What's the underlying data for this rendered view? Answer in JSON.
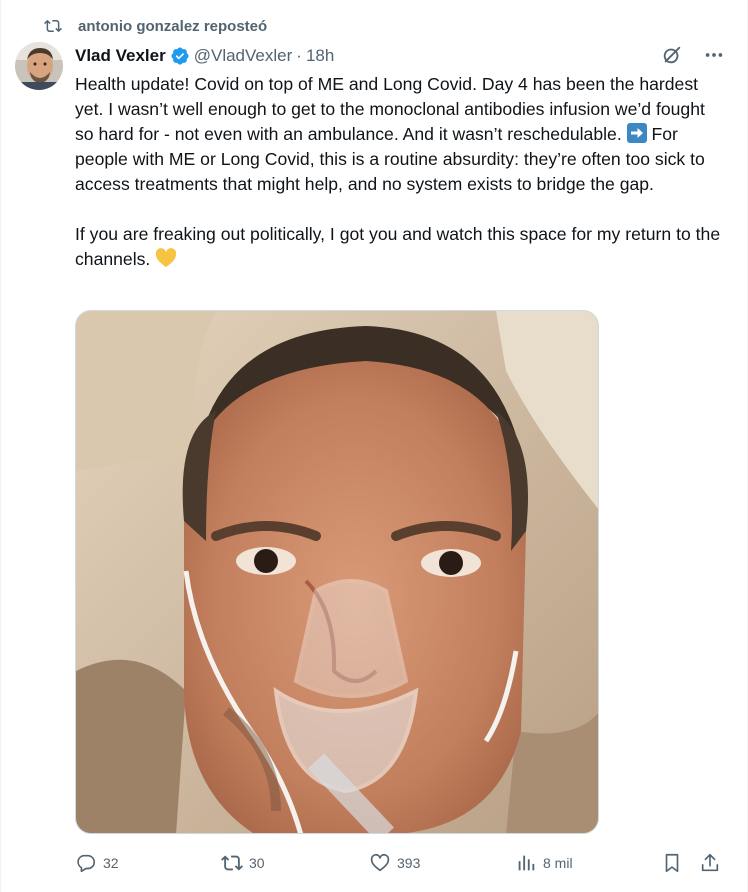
{
  "repost": {
    "label": "antonio gonzalez reposteó"
  },
  "author": {
    "name": "Vlad Vexler",
    "handle": "@VladVexler",
    "separator": "·",
    "time": "18h"
  },
  "post": {
    "para1_part1": "Health update! Covid on top of ME and Long Covid. Day 4 has been the hardest yet. I wasn’t well enough to get to the monoclonal antibodies infusion we’d fought so hard for - not even with an ambulance. And it wasn’t reschedulable.",
    "para1_part2": "For people with ME or Long Covid, this is a routine absurdity: they’re often too sick to access treatments that might help, and no system exists to bridge  the gap.",
    "para2": "If you are freaking out politically, I got you and watch this space for my return to the channels."
  },
  "stats": {
    "replies": "32",
    "reposts": "30",
    "likes": "393",
    "views": "8 mil"
  },
  "colors": {
    "accent": "#1d9bf0",
    "muted": "#536471",
    "text": "#0f1419",
    "heart_emoji": "#f6c343",
    "arrow_emoji": "#3b88c3"
  },
  "icons": {
    "repost": "repost-icon",
    "verified": "verified-badge-icon",
    "grok": "grok-icon",
    "more": "more-icon",
    "reply": "reply-icon",
    "like": "heart-icon",
    "views": "views-icon",
    "bookmark": "bookmark-icon",
    "share": "share-icon"
  }
}
